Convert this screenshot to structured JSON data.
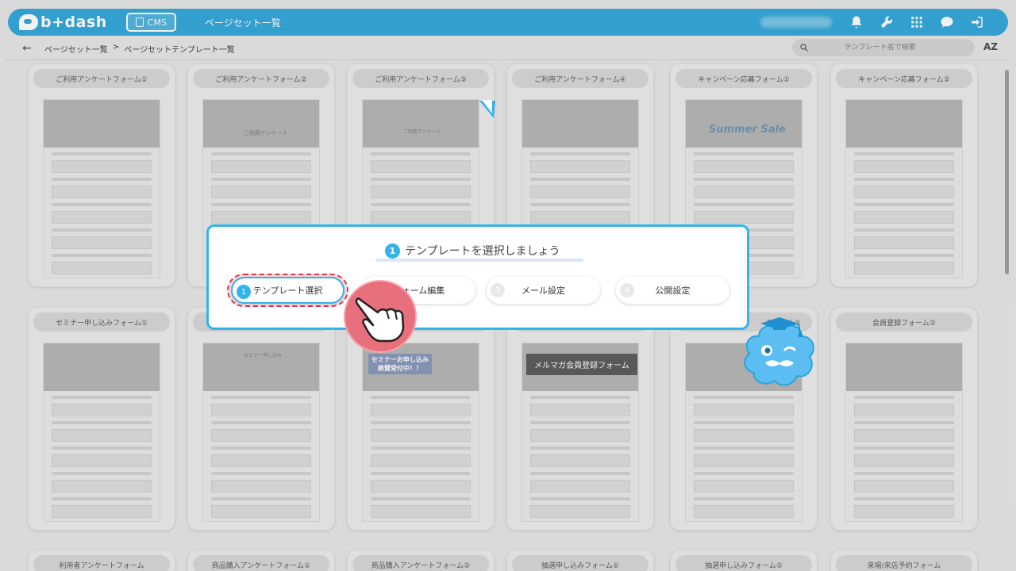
{
  "header": {
    "logo_text": "b+dash",
    "cms_label": "CMS",
    "title": "ページセット一覧",
    "icons": [
      "bell-icon",
      "wrench-icon",
      "grid-icon",
      "chat-icon",
      "logout-icon"
    ]
  },
  "breadcrumb": {
    "back_icon": "back-arrow-icon",
    "items": [
      "ページセット一覧",
      ">",
      "ページセットテンプレート一覧"
    ]
  },
  "search": {
    "placeholder": "テンプレート名で検索"
  },
  "sort": {
    "label": "AZ"
  },
  "cards": {
    "row1": [
      "ご利用アンケートフォーム①",
      "ご利用アンケートフォーム②",
      "ご利用アンケートフォーム③",
      "ご利用アンケートフォーム④",
      "キャンペーン応募フォーム①",
      "キャンペーン応募フォーム②"
    ],
    "row2": [
      "セミナー申し込みフォーム①",
      "",
      "",
      "",
      "",
      "会員登録フォーム②"
    ],
    "row3": [
      "利用者アンケートフォーム",
      "商品購入アンケートフォーム①",
      "商品購入アンケートフォーム②",
      "抽選申し込みフォーム①",
      "抽選申し込みフォーム②",
      "来場/来店予約フォーム"
    ],
    "partial_title_row2_5": "フォーム①"
  },
  "thumb_texts": {
    "summer_sale": "Summer Sale",
    "seminar_banner": "セミナーお申し込み 絶賛受付中！！",
    "mailmag": "メルマガ会員登録フォーム",
    "survey_heading": "ご利用アンケート",
    "seminar_heading": "セミナー申し込み"
  },
  "tutorial": {
    "step_number": "1",
    "title": "テンプレートを選択しましょう",
    "steps": [
      {
        "num": "1",
        "label": "テンプレート選択",
        "active": true
      },
      {
        "num": "2",
        "label": "フォーム編集",
        "active": false
      },
      {
        "num": "3",
        "label": "メール設定",
        "active": false
      },
      {
        "num": "4",
        "label": "公開設定",
        "active": false
      }
    ]
  },
  "colors": {
    "accent": "#33b3ea",
    "header": "#2ba4d9",
    "highlight": "#e0384a"
  }
}
